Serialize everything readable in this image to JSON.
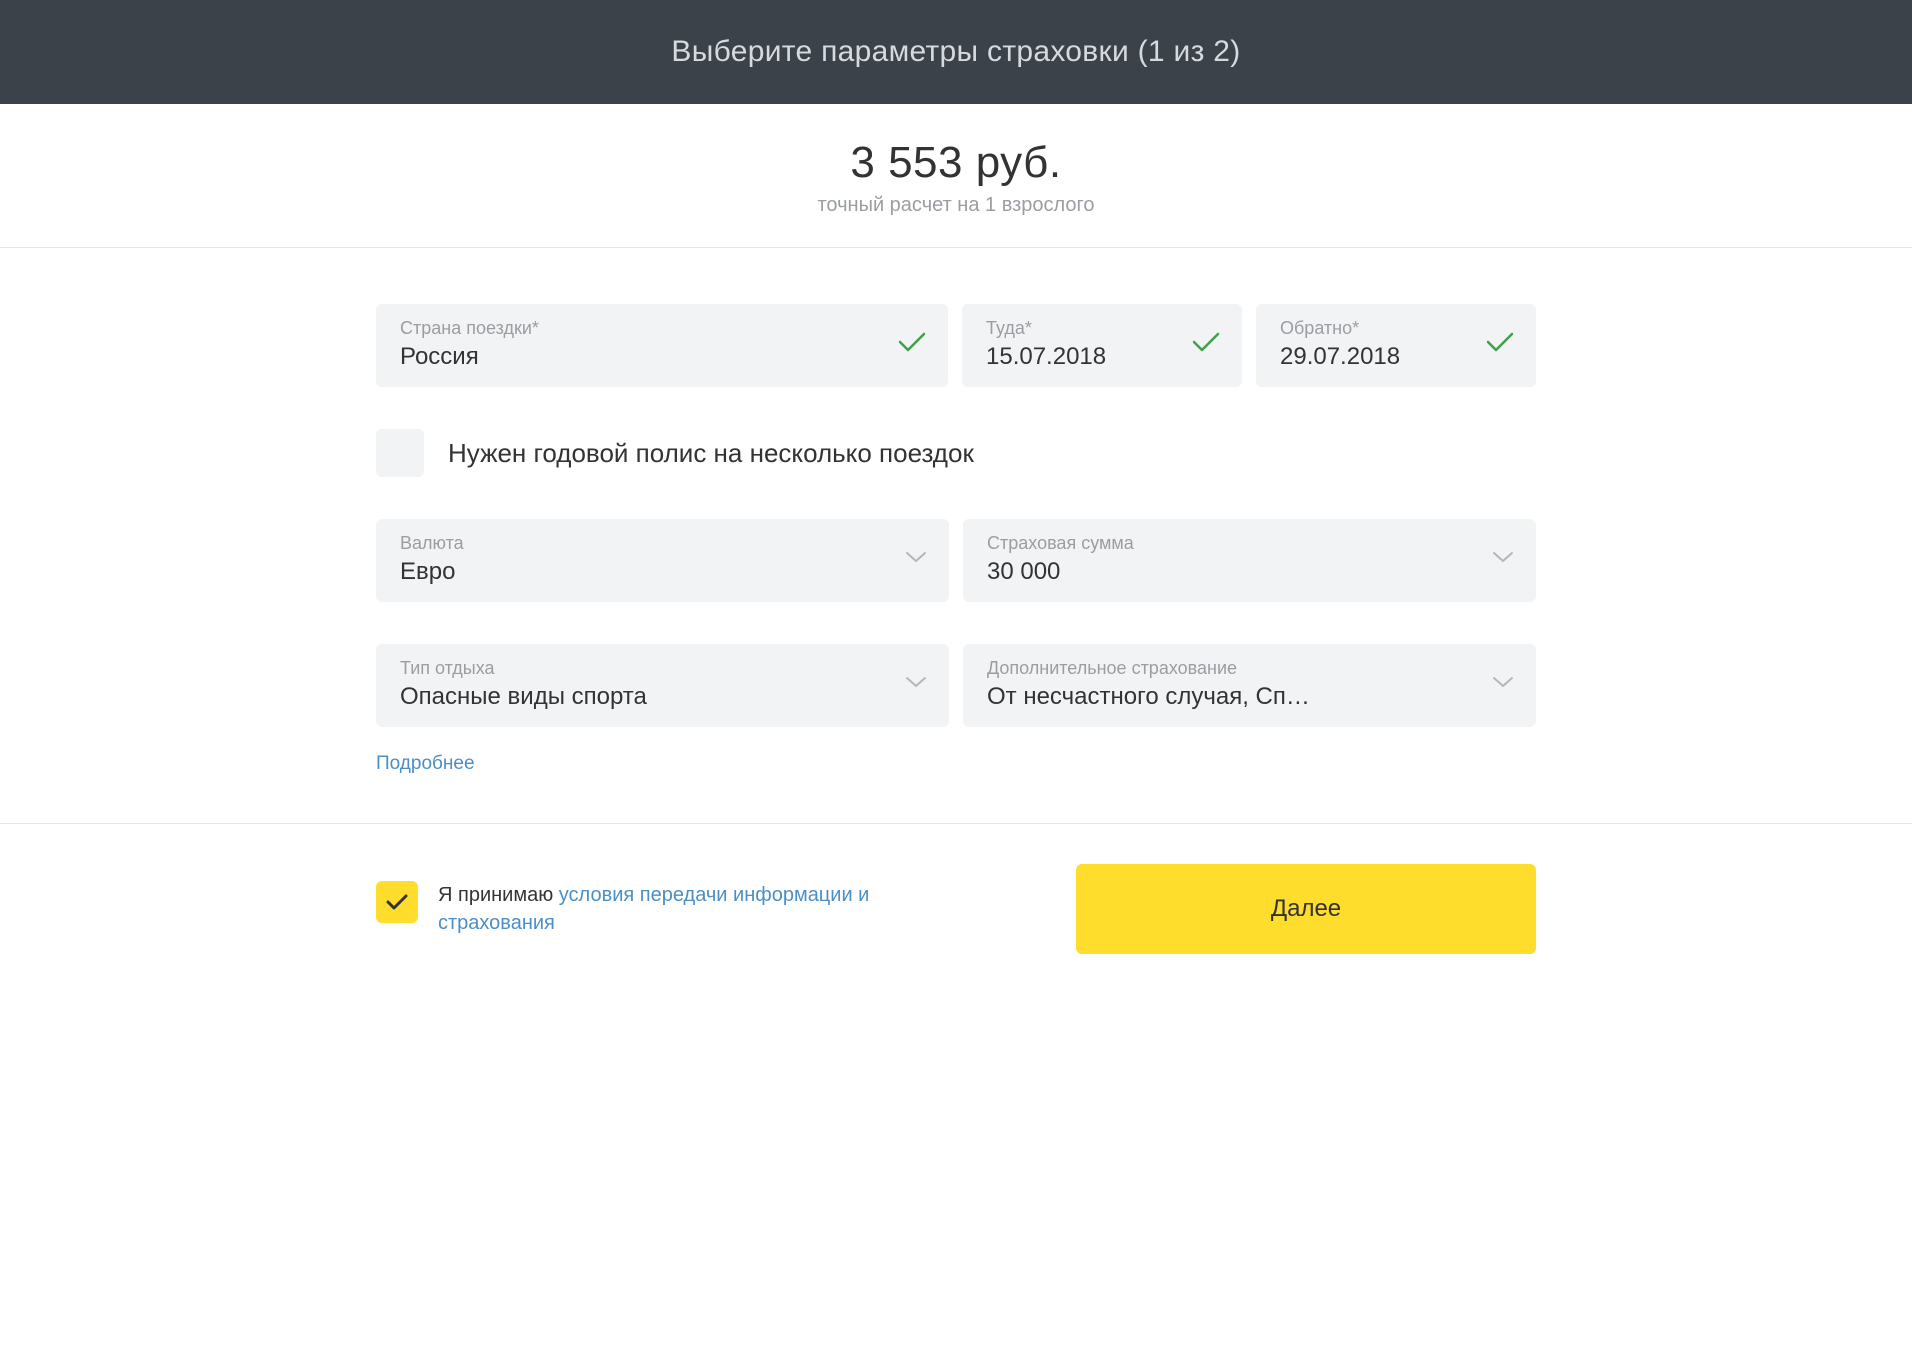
{
  "header": {
    "title": "Выберите параметры страховки (1 из 2)"
  },
  "price": {
    "amount": "3 553 руб.",
    "subtitle": "точный расчет на 1 взрослого"
  },
  "fields": {
    "country": {
      "label": "Страна поездки*",
      "value": "Россия"
    },
    "date_from": {
      "label": "Туда*",
      "value": "15.07.2018"
    },
    "date_to": {
      "label": "Обратно*",
      "value": "29.07.2018"
    },
    "currency": {
      "label": "Валюта",
      "value": "Евро"
    },
    "sum": {
      "label": "Страховая сумма",
      "value": "30 000"
    },
    "rest_type": {
      "label": "Тип отдыха",
      "value": "Опасные виды спорта"
    },
    "additional": {
      "label": "Дополнительное страхование",
      "value": "От несчастного случая, Сп…"
    }
  },
  "yearly_policy": {
    "label": "Нужен годовой полис на несколько поездок"
  },
  "details_link": "Подробнее",
  "accept": {
    "prefix": "Я принимаю ",
    "link": "условия передачи информации и страхования"
  },
  "next_button": "Далее"
}
